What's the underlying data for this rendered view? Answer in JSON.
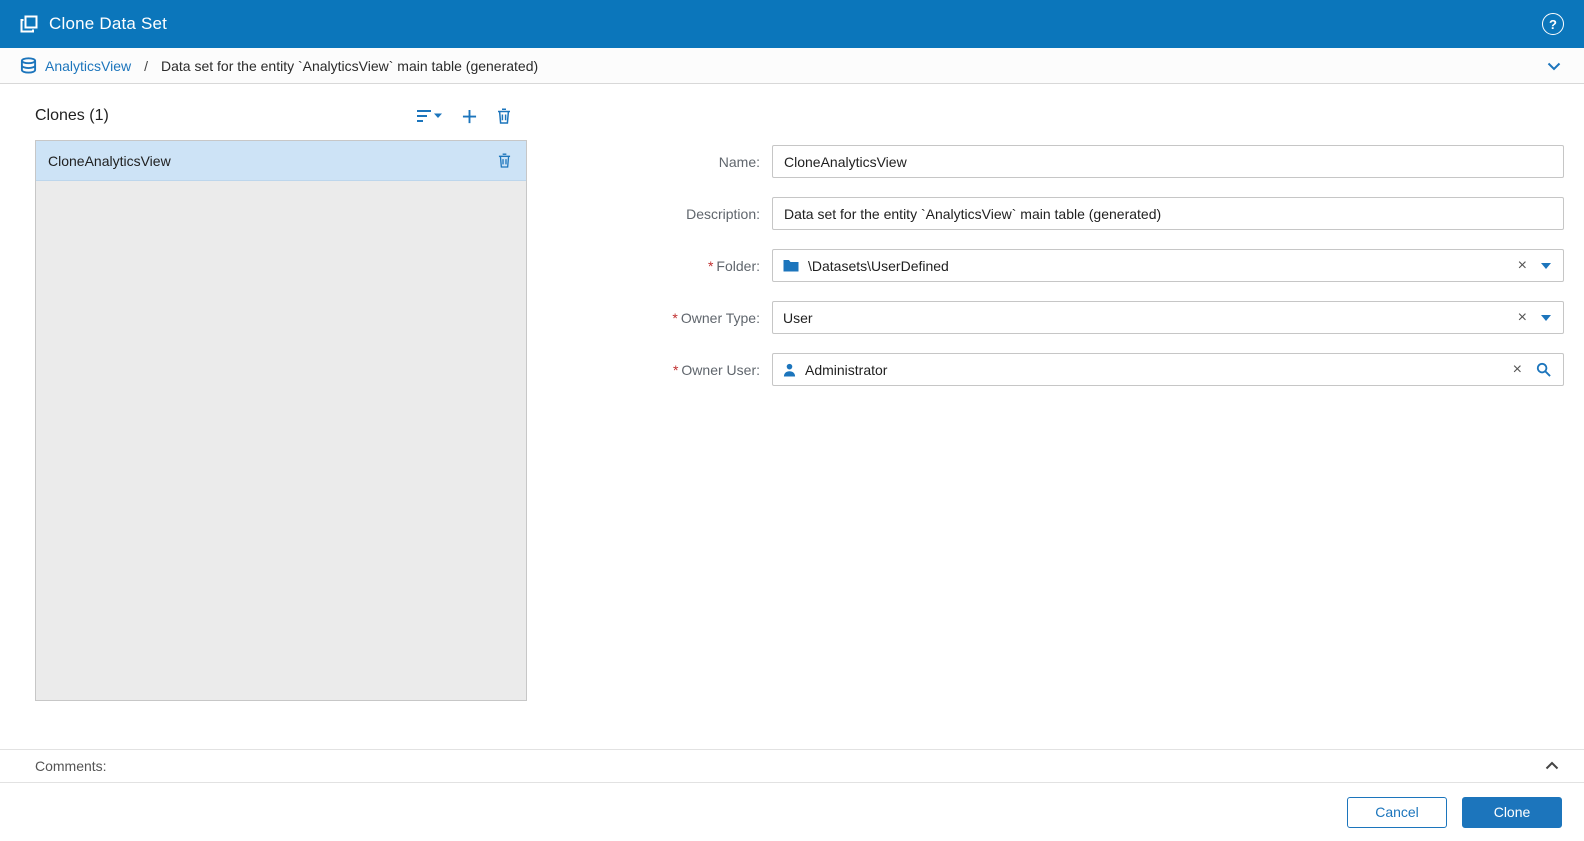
{
  "colors": {
    "header_bg": "#0B76BB",
    "accent": "#1C75BC",
    "selected_row": "#CDE3F6",
    "required": "#C02F2F"
  },
  "icons": {
    "clear": "×",
    "help": "?"
  },
  "header": {
    "title": "Clone Data Set"
  },
  "breadcrumb": {
    "entity": "AnalyticsView",
    "separator": "/",
    "description": "Data set for the entity `AnalyticsView` main table (generated)"
  },
  "clones": {
    "title": "Clones (1)",
    "items": [
      {
        "name": "CloneAnalyticsView"
      }
    ]
  },
  "form": {
    "required_marker": "*",
    "fields": {
      "name": {
        "label": "Name:",
        "value": "CloneAnalyticsView"
      },
      "description": {
        "label": "Description:",
        "value": "Data set for the entity `AnalyticsView` main table (generated)"
      },
      "folder": {
        "label": "Folder:",
        "value": "\\Datasets\\UserDefined"
      },
      "owner_type": {
        "label": "Owner Type:",
        "value": "User"
      },
      "owner_user": {
        "label": "Owner User:",
        "value": "Administrator"
      }
    }
  },
  "comments": {
    "label": "Comments:"
  },
  "footer": {
    "cancel_label": "Cancel",
    "clone_label": "Clone"
  }
}
